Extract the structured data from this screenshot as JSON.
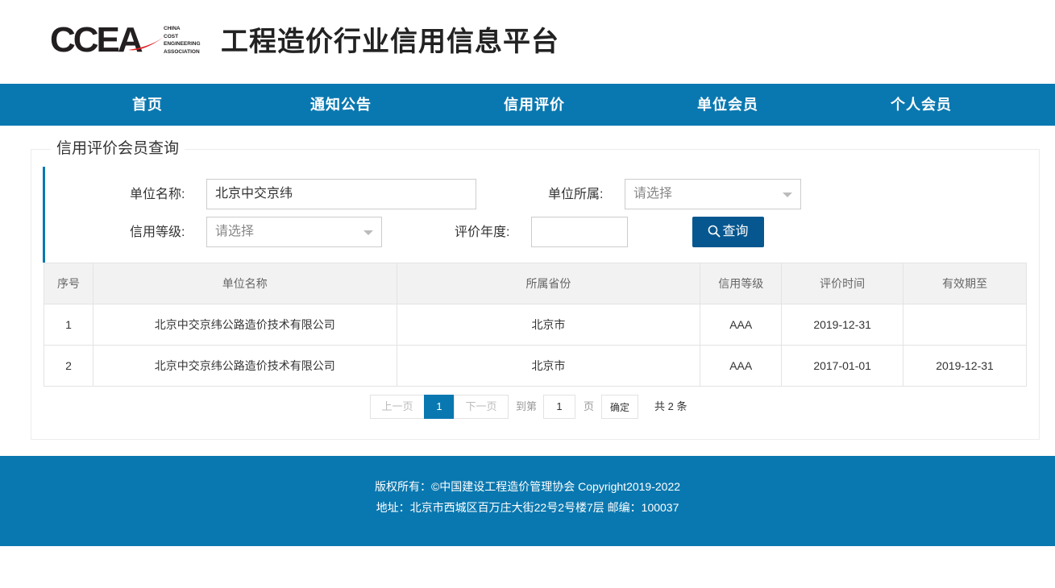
{
  "header": {
    "logo": {
      "letters": "CCEA",
      "sub_lines": [
        "CHINA",
        "COST",
        "ENGINEERING",
        "ASSOCIATION"
      ],
      "accent_color": "#e31e24"
    },
    "site_title": "工程造价行业信用信息平台"
  },
  "nav": {
    "items": [
      {
        "label": "首页"
      },
      {
        "label": "通知公告"
      },
      {
        "label": "信用评价"
      },
      {
        "label": "单位会员"
      },
      {
        "label": "个人会员"
      }
    ],
    "color": "#0a78b0"
  },
  "panel": {
    "title": "信用评价会员查询"
  },
  "search": {
    "unit_name_label": "单位名称:",
    "unit_name_value": "北京中交京纬",
    "province_label": "单位所属:",
    "province_placeholder": "请选择",
    "credit_level_label": "信用等级:",
    "credit_level_placeholder": "请选择",
    "year_label": "评价年度:",
    "year_value": "",
    "search_button": "查询"
  },
  "table": {
    "columns": [
      "序号",
      "单位名称",
      "所属省份",
      "信用等级",
      "评价时间",
      "有效期至"
    ],
    "rows": [
      [
        "1",
        "北京中交京纬公路造价技术有限公司",
        "北京市",
        "AAA",
        "2019-12-31",
        ""
      ],
      [
        "2",
        "北京中交京纬公路造价技术有限公司",
        "北京市",
        "AAA",
        "2017-01-01",
        "2019-12-31"
      ]
    ]
  },
  "pagination": {
    "prev": "上一页",
    "current": "1",
    "next": "下一页",
    "goto_prefix": "到第",
    "goto_value": "1",
    "goto_suffix": "页",
    "confirm": "确定",
    "total": "共 2 条"
  },
  "footer": {
    "copyright": "版权所有：©中国建设工程造价管理协会 Copyright2019-2022",
    "address": "地址：北京市西城区百万庄大街22号2号楼7层  邮编：100037"
  }
}
